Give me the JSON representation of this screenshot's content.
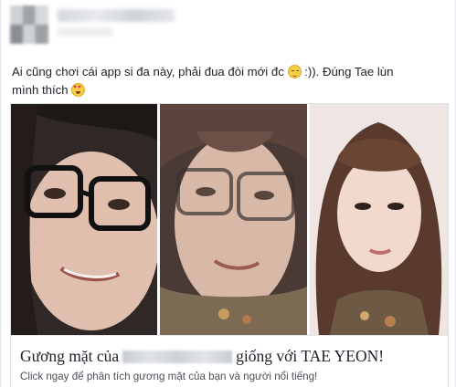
{
  "post": {
    "caption_line1": "Ai cũng chơi cái app si đa này, phải đua đòi mới đc",
    "caption_after_emoji": ":)). Đúng Tae lùn",
    "caption_line2": "mình thích",
    "emoji_1": "relieved-face-icon",
    "emoji_2": "heart-eyes-face-icon"
  },
  "link_card": {
    "title_before": "Gương mặt của",
    "title_after": "giống với TAE YEON!",
    "description": "Click ngay để phân tích gương mặt của bạn và người nổi tiếng!"
  },
  "colors": {
    "text": "#1d2129",
    "secondary_text": "#4b4f56",
    "border": "#dddfe2"
  }
}
